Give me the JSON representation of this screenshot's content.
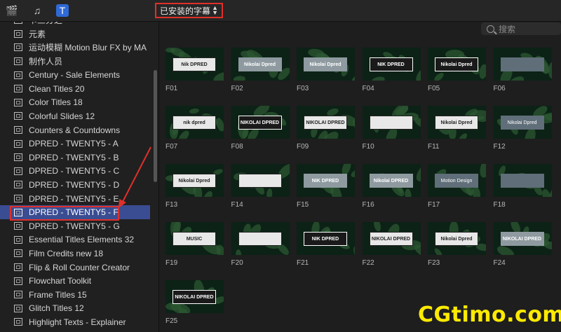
{
  "toolbar": {
    "icons": [
      "clapperboard-icon",
      "music-notes-icon",
      "titles-icon"
    ],
    "dropdown_label": "已安装的字幕"
  },
  "search": {
    "placeholder": "搜索"
  },
  "sidebar": {
    "items": [
      {
        "label": "卡三分之一"
      },
      {
        "label": "元素"
      },
      {
        "label": "运动模糊 Motion Blur FX by MA"
      },
      {
        "label": "制作人员"
      },
      {
        "label": "Century - Sale Elements"
      },
      {
        "label": "Clean Titles 20"
      },
      {
        "label": "Color Titles 18"
      },
      {
        "label": "Colorful Slides 12"
      },
      {
        "label": "Counters & Countdowns"
      },
      {
        "label": "DPRED - TWENTY5 - A"
      },
      {
        "label": "DPRED - TWENTY5 - B"
      },
      {
        "label": "DPRED - TWENTY5 - C"
      },
      {
        "label": "DPRED - TWENTY5 - D"
      },
      {
        "label": "DPRED - TWENTY5 - E"
      },
      {
        "label": "DPRED - TWENTY5 - F",
        "selected": true
      },
      {
        "label": "DPRED - TWENTY5 - G"
      },
      {
        "label": "Essential Titles Elements 32"
      },
      {
        "label": "Film Credits new 18"
      },
      {
        "label": "Flip & Roll Counter Creator"
      },
      {
        "label": "Flowchart Toolkit"
      },
      {
        "label": "Frame Titles 15"
      },
      {
        "label": "Glitch Titles 12"
      },
      {
        "label": "Highlight Texts - Explainer"
      }
    ]
  },
  "tiles": [
    {
      "label": "F01",
      "text": "Nik DPRED",
      "style": "light"
    },
    {
      "label": "F02",
      "text": "Nikolai Dpred",
      "style": "gray"
    },
    {
      "label": "F03",
      "text": "Nikolai Dpred",
      "style": "gray"
    },
    {
      "label": "F04",
      "text": "NIK DPRED",
      "style": "dark"
    },
    {
      "label": "F05",
      "text": "Nikolai Dpred",
      "style": "dark"
    },
    {
      "label": "F06",
      "text": "",
      "style": "slate"
    },
    {
      "label": "F07",
      "text": "nik dpred",
      "style": "light"
    },
    {
      "label": "F08",
      "text": "NIKOLAI DPRED",
      "style": "dark"
    },
    {
      "label": "F09",
      "text": "NIKOLAI DPRED",
      "style": "light"
    },
    {
      "label": "F10",
      "text": "",
      "style": "light"
    },
    {
      "label": "F11",
      "text": "Nikolai Dpred",
      "style": "light"
    },
    {
      "label": "F12",
      "text": "Nikolai Dpred",
      "style": "slate"
    },
    {
      "label": "F13",
      "text": "Nikolai Dpred",
      "style": "light"
    },
    {
      "label": "F14",
      "text": "",
      "style": "light"
    },
    {
      "label": "F15",
      "text": "NIK DPRED",
      "style": "gray"
    },
    {
      "label": "F16",
      "text": "Nikolai DPRED",
      "style": "gray"
    },
    {
      "label": "F17",
      "text": "Motion Design",
      "style": "slate"
    },
    {
      "label": "F18",
      "text": "",
      "style": "slate"
    },
    {
      "label": "F19",
      "text": "MUSIC",
      "style": "light"
    },
    {
      "label": "F20",
      "text": "",
      "style": "light"
    },
    {
      "label": "F21",
      "text": "NIK DPRED",
      "style": "dark"
    },
    {
      "label": "F22",
      "text": "NIKOLAI DPRED",
      "style": "light"
    },
    {
      "label": "F23",
      "text": "Nikolai Dpred",
      "style": "light"
    },
    {
      "label": "F24",
      "text": "NIKOLAI DPRED",
      "style": "gray"
    },
    {
      "label": "F25",
      "text": "NIKOLAI DPRED",
      "style": "dark"
    }
  ],
  "watermark": "CGtimo.com",
  "colors": {
    "selection": "#3a4d92",
    "highlight_border": "#e0302a",
    "watermark": "#ffea00"
  }
}
